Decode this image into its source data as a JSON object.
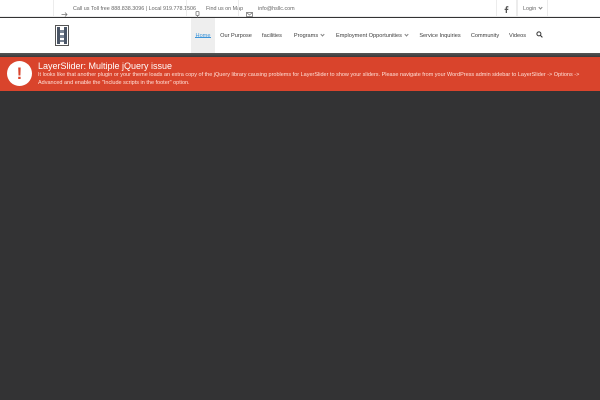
{
  "topbar": {
    "phone": "Call us Toll free 888.838.3096 | Local 919.778.1506",
    "map": "Find us on Map",
    "email": "info@hsllc.com",
    "facebook_icon": "facebook-icon",
    "login": "Login"
  },
  "nav": {
    "items": [
      {
        "label": "Home",
        "active": true
      },
      {
        "label": "Our Purpose"
      },
      {
        "label": "facilities"
      },
      {
        "label": "Programs",
        "has_dropdown": true
      },
      {
        "label": "Employment Opportunities",
        "has_dropdown": true
      },
      {
        "label": "Service Inquiries"
      },
      {
        "label": "Community"
      },
      {
        "label": "Videos"
      }
    ],
    "search_icon": "search-icon",
    "accent_color": "#3b94d9"
  },
  "alert": {
    "title": "LayerSlider: Multiple jQuery issue",
    "message": "It looks like that another plugin or your theme loads an extra copy of the jQuery library causing problems for LayerSlider to show your sliders. Please navigate from your WordPress admin sidebar to LayerSlider -> Options -> Advanced and enable the \"Include scripts in the footer\" option.",
    "icon": "exclamation-icon",
    "color": "#d9442c"
  },
  "colors": {
    "background": "#333334"
  }
}
